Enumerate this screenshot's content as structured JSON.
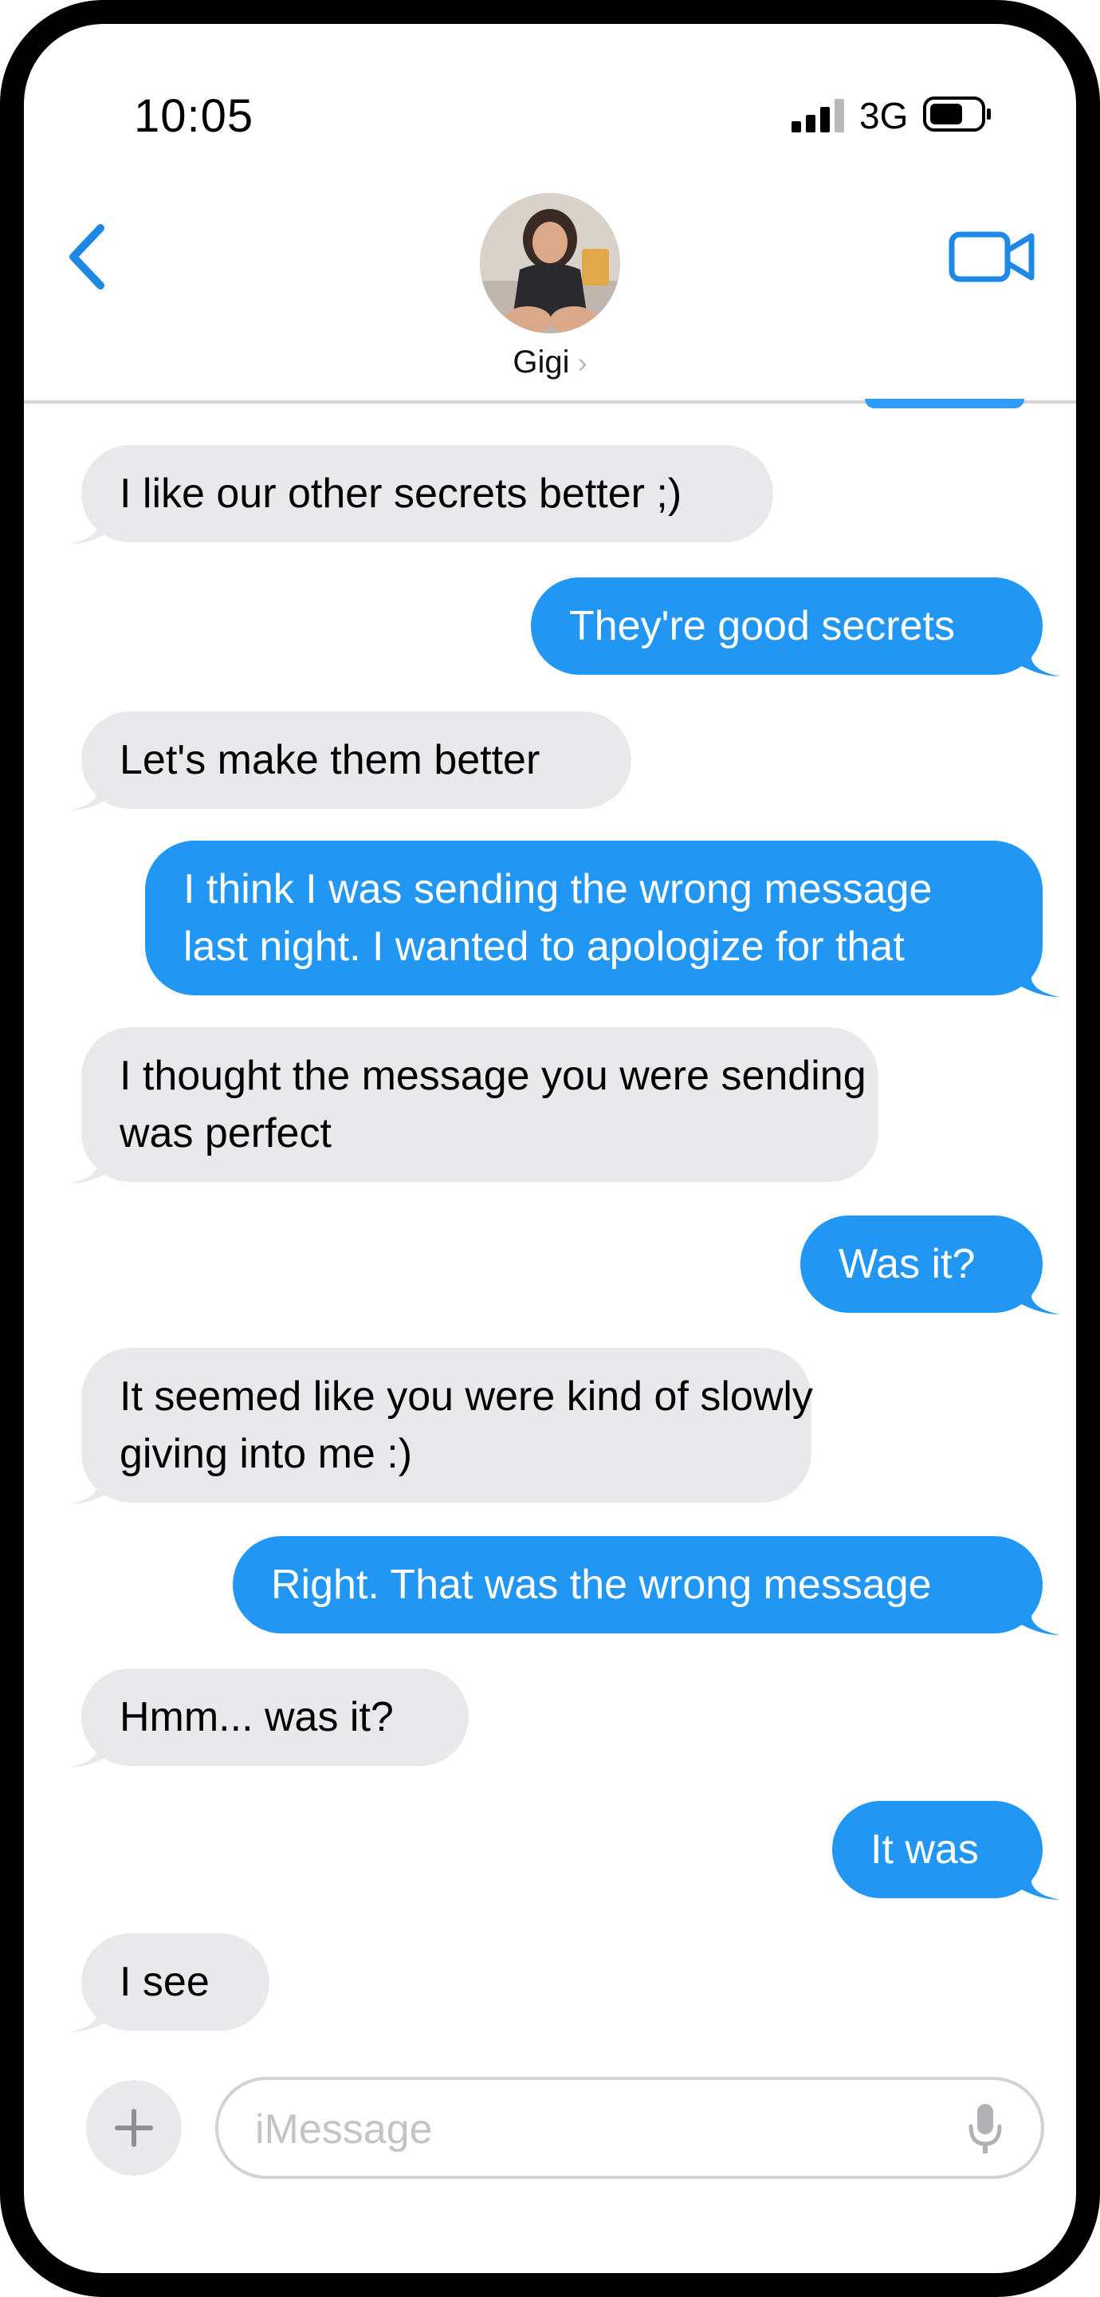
{
  "status_bar": {
    "time": "10:05",
    "network": "3G",
    "icons": [
      "cellular-signal-icon",
      "battery-icon"
    ]
  },
  "header": {
    "back_icon": "chevron-left-icon",
    "contact_name": "Gigi",
    "name_chevron": "›",
    "video_icon": "video-camera-icon"
  },
  "colors": {
    "accent": "#1e88e5",
    "outgoing_bubble": "#2196f3",
    "incoming_bubble": "#e9e9eb"
  },
  "messages": [
    {
      "direction": "in",
      "lines": [
        "I like our other secrets better ;)"
      ]
    },
    {
      "direction": "out",
      "lines": [
        "They're good secrets"
      ]
    },
    {
      "direction": "in",
      "lines": [
        "Let's make them better"
      ]
    },
    {
      "direction": "out",
      "lines": [
        "I think I was sending the wrong message",
        "last night.  I wanted to apologize for that"
      ]
    },
    {
      "direction": "in",
      "lines": [
        "I thought the message you were sending",
        "was perfect"
      ]
    },
    {
      "direction": "out",
      "lines": [
        "Was it?"
      ]
    },
    {
      "direction": "in",
      "lines": [
        "It seemed like you were kind of slowly",
        "giving into me :)"
      ]
    },
    {
      "direction": "out",
      "lines": [
        "Right.  That was the wrong message"
      ]
    },
    {
      "direction": "in",
      "lines": [
        "Hmm... was it?"
      ]
    },
    {
      "direction": "out",
      "lines": [
        "It was"
      ]
    },
    {
      "direction": "in",
      "lines": [
        "I see"
      ]
    }
  ],
  "input_bar": {
    "placeholder": "iMessage",
    "plus_icon": "plus-icon",
    "mic_icon": "microphone-icon"
  }
}
